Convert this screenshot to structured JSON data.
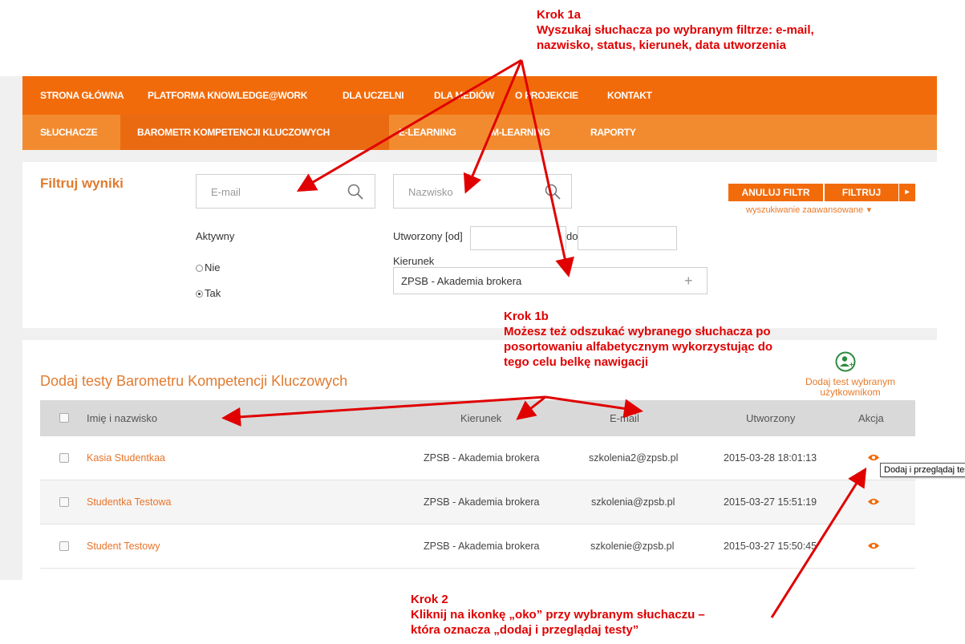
{
  "top_nav": [
    "STRONA GŁÓWNA",
    "PLATFORMA KNOWLEDGE@WORK",
    "DLA UCZELNI",
    "DLA MEDIÓW",
    "O PROJEKCIE",
    "KONTAKT"
  ],
  "sub_nav": [
    "SŁUCHACZE",
    "BAROMETR KOMPETENCJI KLUCZOWYCH",
    "E-LEARNING",
    "M-LEARNING",
    "RAPORTY"
  ],
  "filter": {
    "title": "Filtruj wyniki",
    "email_placeholder": "E-mail",
    "surname_placeholder": "Nazwisko",
    "active_label": "Aktywny",
    "option_no": "Nie",
    "option_yes": "Tak",
    "selected_active": "Tak",
    "created_from_label": "Utworzony [od]",
    "created_to_label": "do",
    "direction_label": "Kierunek",
    "direction_value": "ZPSB - Akademia brokera",
    "direction_plus": "+",
    "cancel_button": "ANULUJ FILTR",
    "filter_button": "FILTRUJ",
    "dropdown_caret": "▸",
    "advanced_link": "wyszukiwanie zaawansowane",
    "advanced_caret": "▾"
  },
  "section": {
    "title": "Dodaj testy Barometru Kompetencji Kluczowych",
    "add_test_line1": "Dodaj test wybranym",
    "add_test_line2": "użytkownikom"
  },
  "table": {
    "headers": {
      "name": "Imię i nazwisko",
      "direction": "Kierunek",
      "email": "E-mail",
      "created": "Utworzony",
      "action": "Akcja"
    },
    "rows": [
      {
        "name": "Kasia Studentkaa",
        "direction": "ZPSB - Akademia brokera",
        "email": "szkolenia2@zpsb.pl",
        "created": "2015-03-28 18:01:13"
      },
      {
        "name": "Studentka Testowa",
        "direction": "ZPSB - Akademia brokera",
        "email": "szkolenia@zpsb.pl",
        "created": "2015-03-27 15:51:19"
      },
      {
        "name": "Student Testowy",
        "direction": "ZPSB - Akademia brokera",
        "email": "szkolenie@zpsb.pl",
        "created": "2015-03-27 15:50:45"
      }
    ],
    "tooltip": "Dodaj i przeglądaj test"
  },
  "annotations": {
    "step1a": [
      "Krok 1a",
      "Wyszukaj słuchacza po wybranym filtrze: e-mail,",
      "nazwisko, status, kierunek, data utworzenia"
    ],
    "step1b": [
      "Krok 1b",
      "Możesz też odszukać wybranego słuchacza po",
      "posortowaniu alfabetycznym wykorzystując do",
      "tego celu belkę nawigacji"
    ],
    "step2": [
      "Krok 2",
      "Kliknij na ikonkę „oko” przy wybranym słuchaczu –",
      "która oznacza „dodaj i przeglądaj testy”"
    ]
  },
  "colors": {
    "accent": "#f26b0a",
    "sub_nav": "#f28b30",
    "annotation": "#e00000"
  }
}
